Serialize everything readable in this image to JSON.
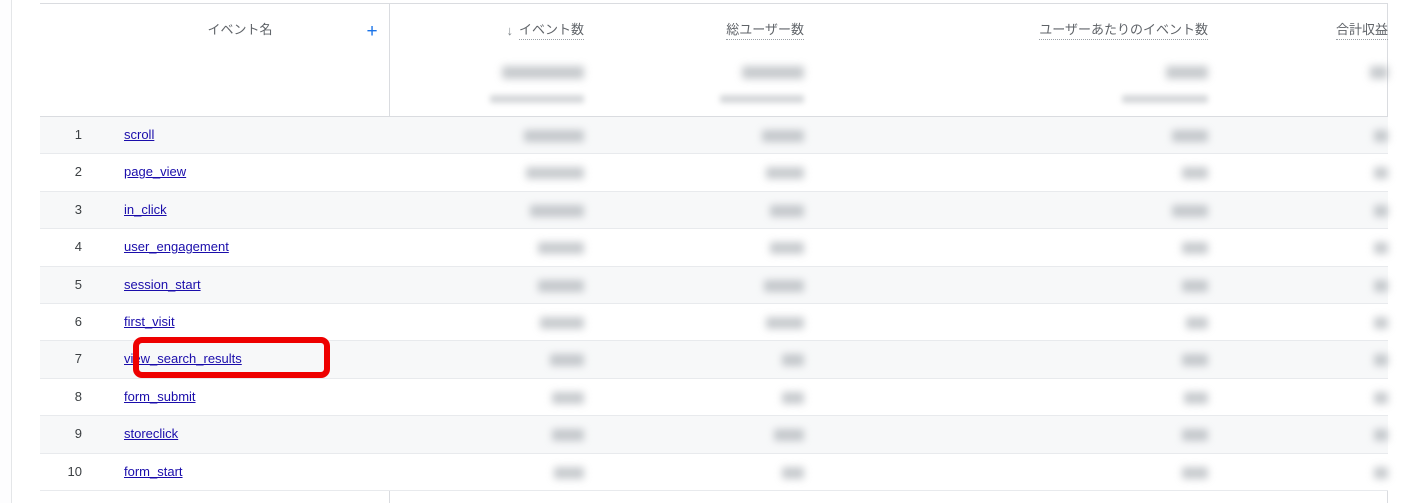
{
  "table": {
    "dimension_header": {
      "label": "イベント名",
      "add_dimension_label": "+"
    },
    "metric_headers": [
      {
        "label": "イベント数",
        "sorted": true,
        "sort_icon": "arrow-down-icon",
        "sort_glyph": "↓"
      },
      {
        "label": "総ユーザー数",
        "sorted": false
      },
      {
        "label": "ユーザーあたりのイベント数",
        "sorted": false
      },
      {
        "label": "合計収益",
        "sorted": false
      }
    ],
    "summary_row": {
      "obscured": true,
      "cells": [
        {
          "primary_width": 82,
          "secondary_width": 94
        },
        {
          "primary_width": 62,
          "secondary_width": 84
        },
        {
          "primary_width": 42,
          "secondary_width": 86
        },
        {
          "primary_width": 18,
          "secondary_width": 0
        }
      ]
    },
    "rows": [
      {
        "index": "1",
        "event_name": "scroll",
        "metrics_obscured": true,
        "metric_widths": [
          60,
          42,
          36,
          14
        ]
      },
      {
        "index": "2",
        "event_name": "page_view",
        "metrics_obscured": true,
        "metric_widths": [
          58,
          38,
          26,
          14
        ]
      },
      {
        "index": "3",
        "event_name": "in_click",
        "metrics_obscured": true,
        "metric_widths": [
          54,
          34,
          36,
          14
        ]
      },
      {
        "index": "4",
        "event_name": "user_engagement",
        "metrics_obscured": true,
        "metric_widths": [
          46,
          34,
          26,
          14
        ]
      },
      {
        "index": "5",
        "event_name": "session_start",
        "metrics_obscured": true,
        "metric_widths": [
          46,
          40,
          26,
          14
        ]
      },
      {
        "index": "6",
        "event_name": "first_visit",
        "metrics_obscured": true,
        "metric_widths": [
          44,
          38,
          22,
          14
        ]
      },
      {
        "index": "7",
        "event_name": "view_search_results",
        "metrics_obscured": true,
        "metric_widths": [
          34,
          22,
          26,
          14
        ],
        "highlighted": true
      },
      {
        "index": "8",
        "event_name": "form_submit",
        "metrics_obscured": true,
        "metric_widths": [
          32,
          22,
          24,
          14
        ]
      },
      {
        "index": "9",
        "event_name": "storeclick",
        "metrics_obscured": true,
        "metric_widths": [
          32,
          30,
          26,
          14
        ]
      },
      {
        "index": "10",
        "event_name": "form_start",
        "metrics_obscured": true,
        "metric_widths": [
          30,
          22,
          26,
          14
        ]
      }
    ]
  },
  "annotation": {
    "type": "highlight-rectangle",
    "color": "#ee0000",
    "target_event_name": "view_search_results",
    "target_row_index": "7"
  },
  "colors": {
    "link": "#1a0dab",
    "accent": "#1a73e8",
    "header_text": "#5f6368",
    "row_text": "#3c4043",
    "row_stripe": "#f7f8f9",
    "row_border": "#e8eaed",
    "rule": "#dadce0",
    "annotation": "#ee0000"
  }
}
